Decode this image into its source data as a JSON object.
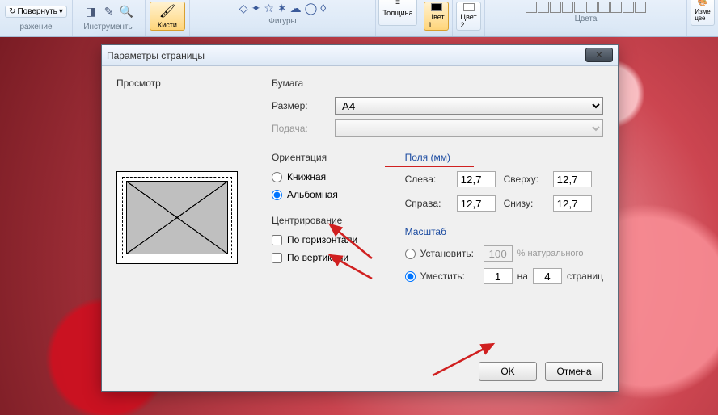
{
  "ribbon": {
    "rotate": "Повернуть",
    "group1": "ражение",
    "tools": "Инструменты",
    "brushes": "Кисти",
    "shapes": "Фигуры",
    "thickness": "Толщина",
    "color1": "Цвет 1",
    "color2": "Цвет 2",
    "colors": "Цвета",
    "edit": "Изме цве"
  },
  "dialog": {
    "title": "Параметры страницы",
    "preview": "Просмотр",
    "paper": "Бумага",
    "size_lbl": "Размер:",
    "size_val": "A4",
    "feed_lbl": "Подача:",
    "feed_val": "",
    "orientation": "Ориентация",
    "portrait": "Книжная",
    "landscape": "Альбомная",
    "margins": "Поля (мм)",
    "left": "Слева:",
    "right": "Справа:",
    "top": "Сверху:",
    "bottom": "Снизу:",
    "m_left": "12,7",
    "m_right": "12,7",
    "m_top": "12,7",
    "m_bottom": "12,7",
    "centering": "Центрирование",
    "horiz": "По горизонтали",
    "vert": "По вертикали",
    "scale": "Масштаб",
    "set": "Установить:",
    "set_val": "100",
    "set_pct": "% натурального",
    "fit": "Уместить:",
    "fit_w": "1",
    "fit_on": "на",
    "fit_h": "4",
    "fit_pages": "страниц",
    "ok": "OK",
    "cancel": "Отмена"
  }
}
